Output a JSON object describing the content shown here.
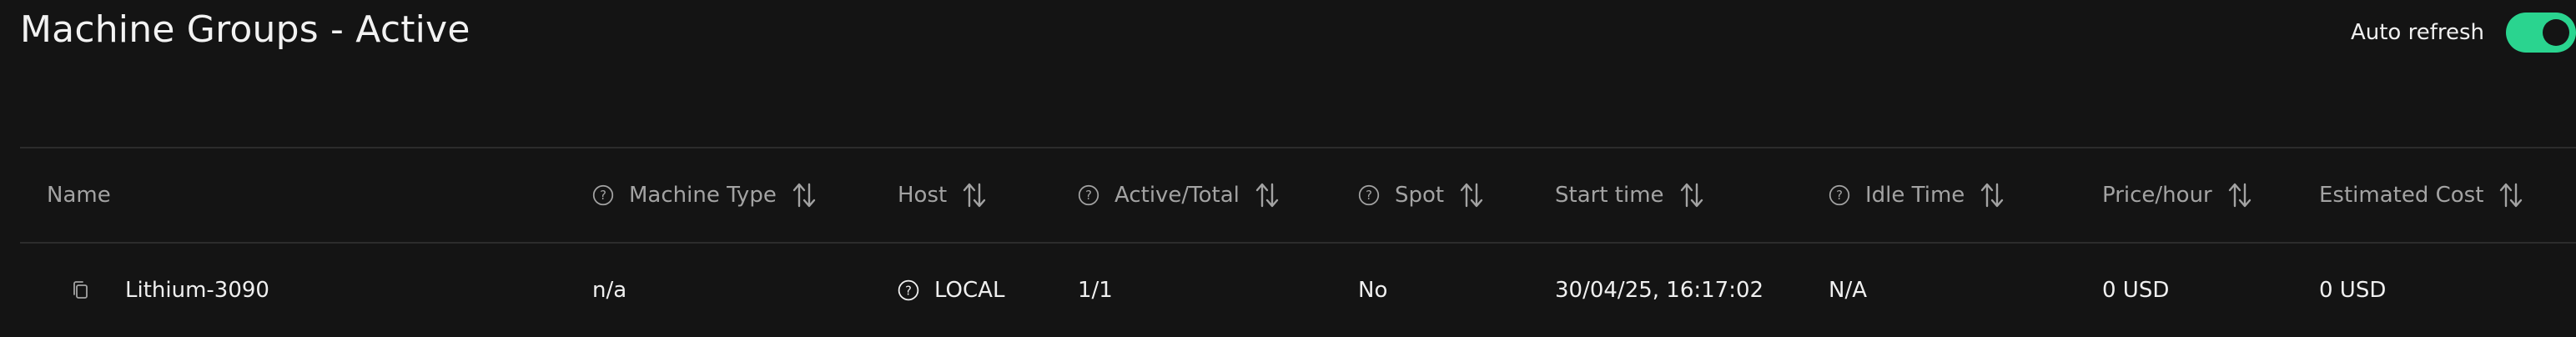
{
  "page": {
    "title": "Machine Groups - Active"
  },
  "auto_refresh": {
    "label": "Auto refresh",
    "enabled": true,
    "accent_color": "#2ad48f"
  },
  "table": {
    "headers": {
      "name": "Name",
      "machine_type": "Machine Type",
      "host": "Host",
      "active_total": "Active/Total",
      "spot": "Spot",
      "start_time": "Start time",
      "idle_time": "Idle Time",
      "price_hour": "Price/hour",
      "estimated_cost": "Estimated Cost"
    },
    "rows": [
      {
        "name": "Lithium-3090",
        "machine_type": "n/a",
        "host": "LOCAL",
        "active_total": "1/1",
        "spot": "No",
        "start_time": "30/04/25, 16:17:02",
        "idle_time": "N/A",
        "price_hour": "0 USD",
        "estimated_cost": "0 USD"
      }
    ]
  },
  "icons": {
    "help": "help-circle-icon",
    "sort": "sort-arrows-icon",
    "copy": "copy-icon"
  }
}
